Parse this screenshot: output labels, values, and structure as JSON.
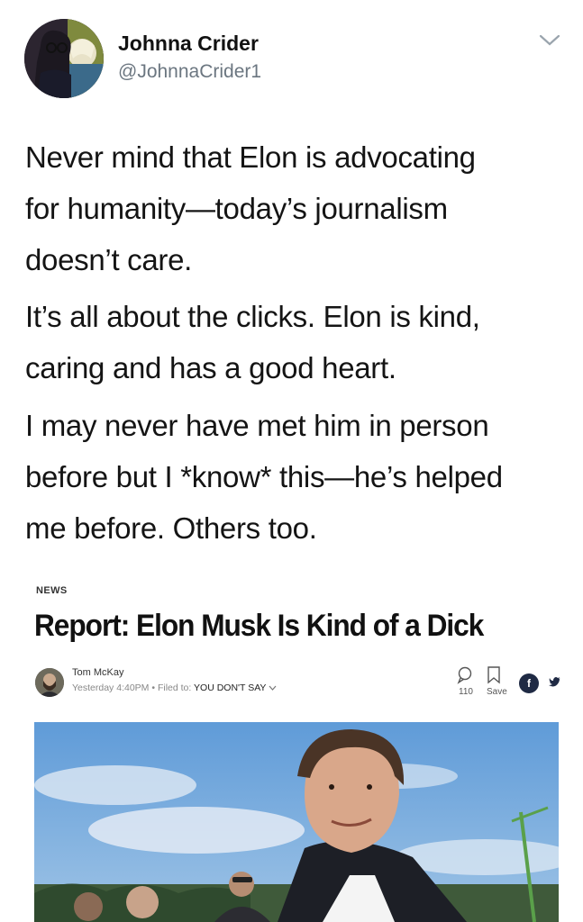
{
  "tweet": {
    "author": {
      "display_name": "Johnna Crider",
      "handle": "@JohnnaCrider1"
    },
    "paragraphs": [
      "Never mind that Elon is advocating for humanity—today’s journalism doesn’t care.",
      "It’s all about the clicks. Elon is kind, caring and has a good heart.",
      "I may never have met him in person before but I *know* this—he’s helped me before. Others too."
    ],
    "lines": [
      [
        "Never mind that Elon is advocating",
        "for humanity—today’s journalism",
        "doesn’t care."
      ],
      [
        "It’s all about the clicks. Elon is kind,",
        "caring and has a good heart."
      ],
      [
        "I may never have met him in person",
        "before but I *know* this—he’s helped",
        "me before. Others too."
      ]
    ]
  },
  "article": {
    "section_tag": "NEWS",
    "headline": "Report: Elon Musk Is Kind of a Dick",
    "author": "Tom McKay",
    "timestamp": "Yesterday 4:40PM",
    "separator": "•",
    "filed_to_label": "Filed to:",
    "filed_to_value": "YOU DON'T SAY",
    "comment_count": "110",
    "save_label": "Save"
  },
  "icons": {
    "menu": "chevron-down-icon",
    "comment": "comment-icon",
    "save": "bookmark-icon",
    "facebook": "facebook-icon",
    "twitter": "twitter-icon"
  },
  "colors": {
    "handle": "#6b7680",
    "text": "#141414",
    "share_icon": "#1f2a44"
  }
}
